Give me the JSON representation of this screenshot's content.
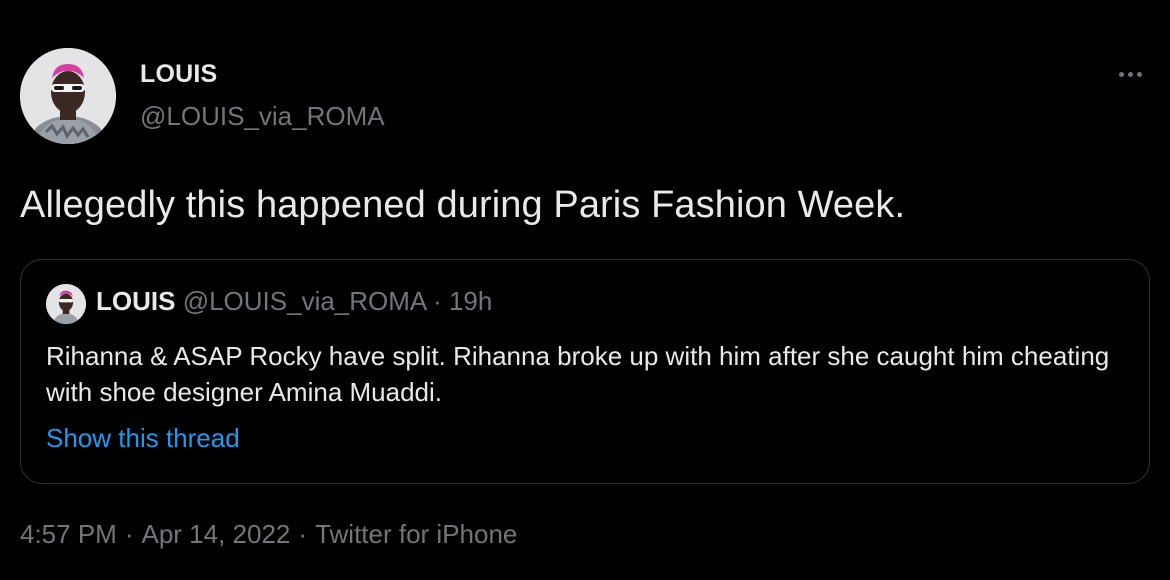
{
  "tweet": {
    "author_name": "LOUIS",
    "author_handle": "@LOUIS_via_ROMA",
    "more_icon": "more-horizontal-icon",
    "text": "Allegedly this happened during Paris Fashion Week.",
    "quote": {
      "author_name": "LOUIS",
      "author_handle": "@LOUIS_via_ROMA",
      "dot": "·",
      "time": "19h",
      "text": "Rihanna & ASAP Rocky have split. Rihanna broke up with him after she caught him cheating with shoe designer Amina Muaddi.",
      "thread_link": "Show this thread"
    },
    "meta": {
      "time": "4:57 PM",
      "sep1": "·",
      "date": "Apr 14, 2022",
      "sep2": "·",
      "source": "Twitter for iPhone"
    }
  },
  "colors": {
    "background": "#000000",
    "primary_text": "#e7e9ea",
    "secondary_text": "#71767b",
    "link": "#1d9bf0",
    "border": "#2f3336"
  }
}
